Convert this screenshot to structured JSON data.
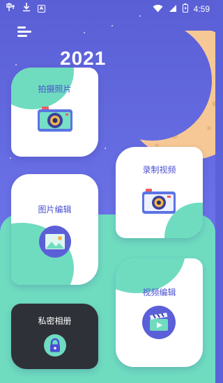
{
  "status_bar": {
    "time": "4:59",
    "left_icons": [
      "notification-icon",
      "download-icon",
      "a-icon"
    ],
    "right_icons": [
      "wifi-icon",
      "signal-icon",
      "battery-charging-icon"
    ],
    "a_glyph": "A"
  },
  "header": {
    "year": "2021",
    "menu_icon": "hamburger-icon"
  },
  "colors": {
    "background": "#5a5fd6",
    "accent_mint": "#6fdcc0",
    "label_blue": "#4a4fd1",
    "moon": "#f6c895",
    "dark_card": "#2f3138"
  },
  "cards": [
    {
      "id": "take-photo",
      "label": "拍摄照片",
      "icon": "camera-icon"
    },
    {
      "id": "record-video",
      "label": "录制视频",
      "icon": "video-camera-icon"
    },
    {
      "id": "photo-edit",
      "label": "图片编辑",
      "icon": "image-icon"
    },
    {
      "id": "video-edit",
      "label": "视频编辑",
      "icon": "clapperboard-icon"
    },
    {
      "id": "private-album",
      "label": "私密相册",
      "icon": "lock-icon"
    }
  ]
}
